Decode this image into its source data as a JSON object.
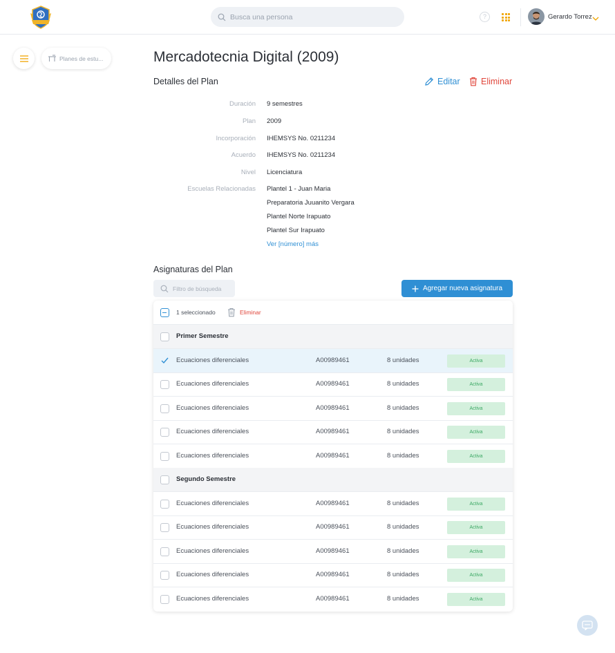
{
  "header": {
    "search_placeholder": "Busca una persona",
    "user_name": "Gerardo Torrez",
    "help_glyph": "?",
    "accent_color": "#f0a500"
  },
  "breadcrumb": {
    "label": "Planes de estu..."
  },
  "page": {
    "title": "Mercadotecnia Digital (2009)",
    "details_title": "Detalles del Plan",
    "edit_label": "Editar",
    "delete_label": "Eliminar"
  },
  "details": {
    "fields": [
      {
        "label": "Duración",
        "value": "9 semestres"
      },
      {
        "label": "Plan",
        "value": "2009"
      },
      {
        "label": "Incorporación",
        "value": "IHEMSYS No. 0211234"
      },
      {
        "label": "Acuerdo",
        "value": "IHEMSYS No. 0211234"
      },
      {
        "label": "Nivel",
        "value": "Licenciatura"
      }
    ],
    "schools_label": "Escuelas Relacionadas",
    "schools": [
      "Plantel 1 - Juan Maria",
      "Preparatoria Juuanito Vergara",
      "Plantel Norte Irapuato",
      "Plantel Sur Irapuato"
    ],
    "more_link": "Ver [número] más"
  },
  "subjects": {
    "title": "Asignaturas del Plan",
    "filter_placeholder": "Filtro de búsqueda",
    "add_button": "Agregar nueva asignatura",
    "selection_count": "1 seleccionado",
    "selection_delete": "Eliminar",
    "groups": [
      {
        "name": "Primer Semestre",
        "rows": [
          {
            "name": "Ecuaciones diferenciales",
            "code": "A00989461",
            "units": "8 unidades",
            "status": "Activa",
            "selected": true
          },
          {
            "name": "Ecuaciones diferenciales",
            "code": "A00989461",
            "units": "8 unidades",
            "status": "Activa",
            "selected": false
          },
          {
            "name": "Ecuaciones diferenciales",
            "code": "A00989461",
            "units": "8 unidades",
            "status": "Activa",
            "selected": false
          },
          {
            "name": "Ecuaciones diferenciales",
            "code": "A00989461",
            "units": "8 unidades",
            "status": "Activa",
            "selected": false
          },
          {
            "name": "Ecuaciones diferenciales",
            "code": "A00989461",
            "units": "8 unidades",
            "status": "Activa",
            "selected": false
          }
        ]
      },
      {
        "name": "Segundo Semestre",
        "rows": [
          {
            "name": "Ecuaciones diferenciales",
            "code": "A00989461",
            "units": "8 unidades",
            "status": "Activa",
            "selected": false
          },
          {
            "name": "Ecuaciones diferenciales",
            "code": "A00989461",
            "units": "8 unidades",
            "status": "Activa",
            "selected": false
          },
          {
            "name": "Ecuaciones diferenciales",
            "code": "A00989461",
            "units": "8 unidades",
            "status": "Activa",
            "selected": false
          },
          {
            "name": "Ecuaciones diferenciales",
            "code": "A00989461",
            "units": "8 unidades",
            "status": "Activa",
            "selected": false
          },
          {
            "name": "Ecuaciones diferenciales",
            "code": "A00989461",
            "units": "8 unidades",
            "status": "Activa",
            "selected": false
          }
        ]
      }
    ]
  }
}
